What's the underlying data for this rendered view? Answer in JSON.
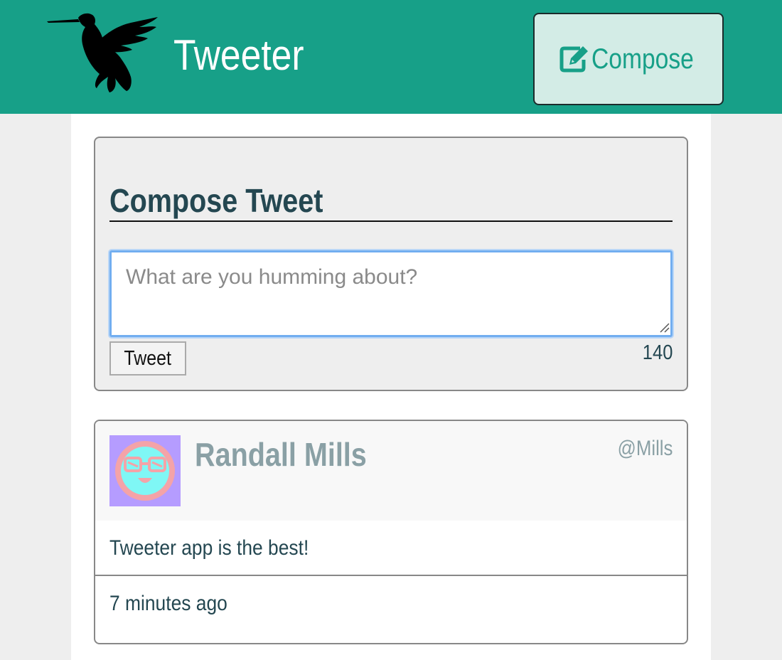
{
  "nav": {
    "brand": "Tweeter",
    "compose_label": "Compose",
    "logo_icon": "hummingbird-icon",
    "compose_icon": "edit-icon"
  },
  "new_tweet": {
    "heading": "Compose Tweet",
    "placeholder": "What are you humming about?",
    "value": "",
    "submit_label": "Tweet",
    "counter": "140"
  },
  "tweets": [
    {
      "author_name": "Randall Mills",
      "handle": "@Mills",
      "content": "Tweeter app is the best!",
      "timestamp": "7 minutes ago",
      "avatar_icon": "avatar-face-icon"
    }
  ],
  "colors": {
    "header_bg": "#17a088",
    "compose_button_bg": "#d3ece6",
    "heading_text": "#244751",
    "muted_text": "#8aa0a5",
    "avatar_bg": "#b59cff",
    "textarea_focus": "#72aef0"
  }
}
